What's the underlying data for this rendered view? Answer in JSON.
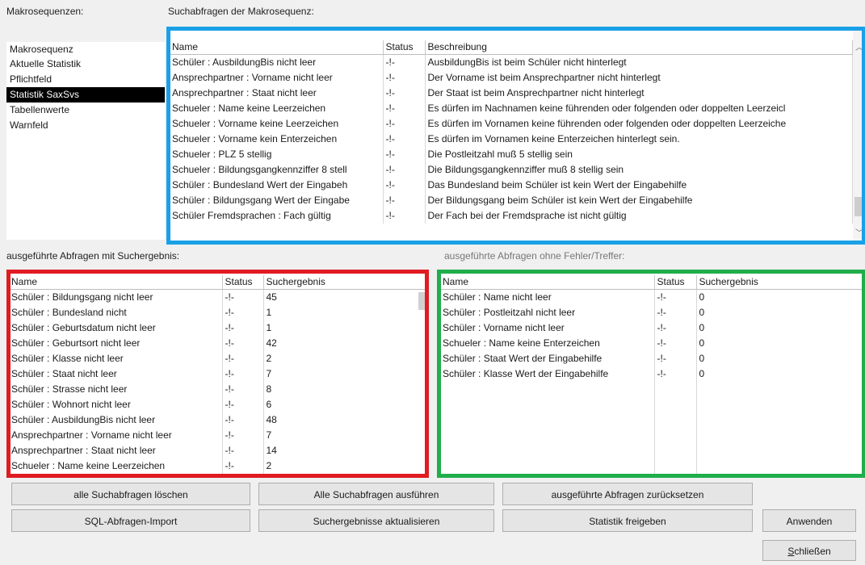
{
  "labels": {
    "makrosequenzen": "Makrosequenzen:",
    "suchabfragen": "Suchabfragen der Makrosequenz:",
    "mit_suchergebnis": "ausgeführte Abfragen mit Suchergebnis:",
    "ohne_fehler": "ausgeführte Abfragen ohne Fehler/Treffer:"
  },
  "sequences": {
    "header": "Makrosequenz",
    "items": [
      "Aktuelle Statistik",
      "Pflichtfeld",
      "Statistik SaxSvs",
      "Tabellenwerte",
      "Warnfeld"
    ],
    "selected_index": 2
  },
  "queries": {
    "columns": [
      "Name",
      "Status",
      "Beschreibung"
    ],
    "rows": [
      [
        "Schüler : AusbildungBis nicht leer",
        "-!-",
        "AusbildungBis ist beim Schüler nicht hinterlegt"
      ],
      [
        "Ansprechpartner : Vorname nicht leer",
        "-!-",
        "Der Vorname ist beim Ansprechpartner nicht hinterlegt"
      ],
      [
        "Ansprechpartner : Staat nicht leer",
        "-!-",
        "Der Staat ist beim Ansprechpartner nicht hinterlegt"
      ],
      [
        "Schueler : Name keine Leerzeichen",
        "-!-",
        "Es dürfen im Nachnamen keine führenden oder folgenden oder doppelten Leerzeicl"
      ],
      [
        "Schueler : Vorname keine Leerzeichen",
        "-!-",
        "Es dürfen im Vornamen keine führenden oder folgenden oder doppelten Leerzeiche"
      ],
      [
        "Schueler : Vorname kein Enterzeichen",
        "-!-",
        "Es dürfen im Vornamen keine Enterzeichen hinterlegt sein."
      ],
      [
        "Schueler : PLZ 5 stellig",
        "-!-",
        "Die Postleitzahl muß 5 stellig sein"
      ],
      [
        "Schueler : Bildungsgangkennziffer 8 stell",
        "-!-",
        "Die Bildungsgangkennziffer muß 8 stellig sein"
      ],
      [
        "Schüler : Bundesland Wert der Eingabeh",
        "-!-",
        "Das Bundesland beim Schüler ist kein Wert der Eingabehilfe"
      ],
      [
        "Schüler : Bildungsgang Wert der Eingabe",
        "-!-",
        "Der Bildungsgang beim Schüler ist kein Wert der Eingabehilfe"
      ],
      [
        "Schüler Fremdsprachen : Fach gültig",
        "-!-",
        "Der Fach bei der Fremdsprache ist nicht gültig"
      ]
    ]
  },
  "results_hit": {
    "columns": [
      "Name",
      "Status",
      "Suchergebnis"
    ],
    "rows": [
      [
        "Schüler : Bildungsgang nicht leer",
        "-!-",
        "45"
      ],
      [
        "Schüler : Bundesland nicht",
        "-!-",
        "1"
      ],
      [
        "Schüler : Geburtsdatum nicht leer",
        "-!-",
        "1"
      ],
      [
        "Schüler : Geburtsort nicht leer",
        "-!-",
        "42"
      ],
      [
        "Schüler : Klasse nicht leer",
        "-!-",
        "2"
      ],
      [
        "Schüler : Staat nicht leer",
        "-!-",
        "7"
      ],
      [
        "Schüler : Strasse nicht leer",
        "-!-",
        "8"
      ],
      [
        "Schüler : Wohnort nicht leer",
        "-!-",
        "6"
      ],
      [
        "Schüler : AusbildungBis nicht leer",
        "-!-",
        "48"
      ],
      [
        "Ansprechpartner : Vorname nicht leer",
        "-!-",
        "7"
      ],
      [
        "Ansprechpartner : Staat nicht leer",
        "-!-",
        "14"
      ],
      [
        "Schueler : Name keine Leerzeichen",
        "-!-",
        "2"
      ]
    ]
  },
  "results_clean": {
    "columns": [
      "Name",
      "Status",
      "Suchergebnis"
    ],
    "rows": [
      [
        "Schüler : Name nicht leer",
        "-!-",
        "0"
      ],
      [
        "Schüler : Postleitzahl nicht leer",
        "-!-",
        "0"
      ],
      [
        "Schüler : Vorname nicht leer",
        "-!-",
        "0"
      ],
      [
        "Schueler : Name keine Enterzeichen",
        "-!-",
        "0"
      ],
      [
        "Schüler : Staat Wert der Eingabehilfe",
        "-!-",
        "0"
      ],
      [
        "Schüler : Klasse Wert der Eingabehilfe",
        "-!-",
        "0"
      ]
    ]
  },
  "buttons": {
    "delete_all": "alle Suchabfragen löschen",
    "run_all": "Alle Suchabfragen ausführen",
    "reset_executed": "ausgeführte Abfragen zurücksetzen",
    "sql_import": "SQL-Abfragen-Import",
    "refresh_results": "Suchergebnisse aktualisieren",
    "release_stats": "Statistik freigeben",
    "apply": "Anwenden",
    "close_first": "S",
    "close_rest": "chließen"
  },
  "colors": {
    "highlight_blue": "#1aa0e6",
    "highlight_red": "#e01b22",
    "highlight_green": "#1fae4b",
    "selection": "#000000"
  }
}
